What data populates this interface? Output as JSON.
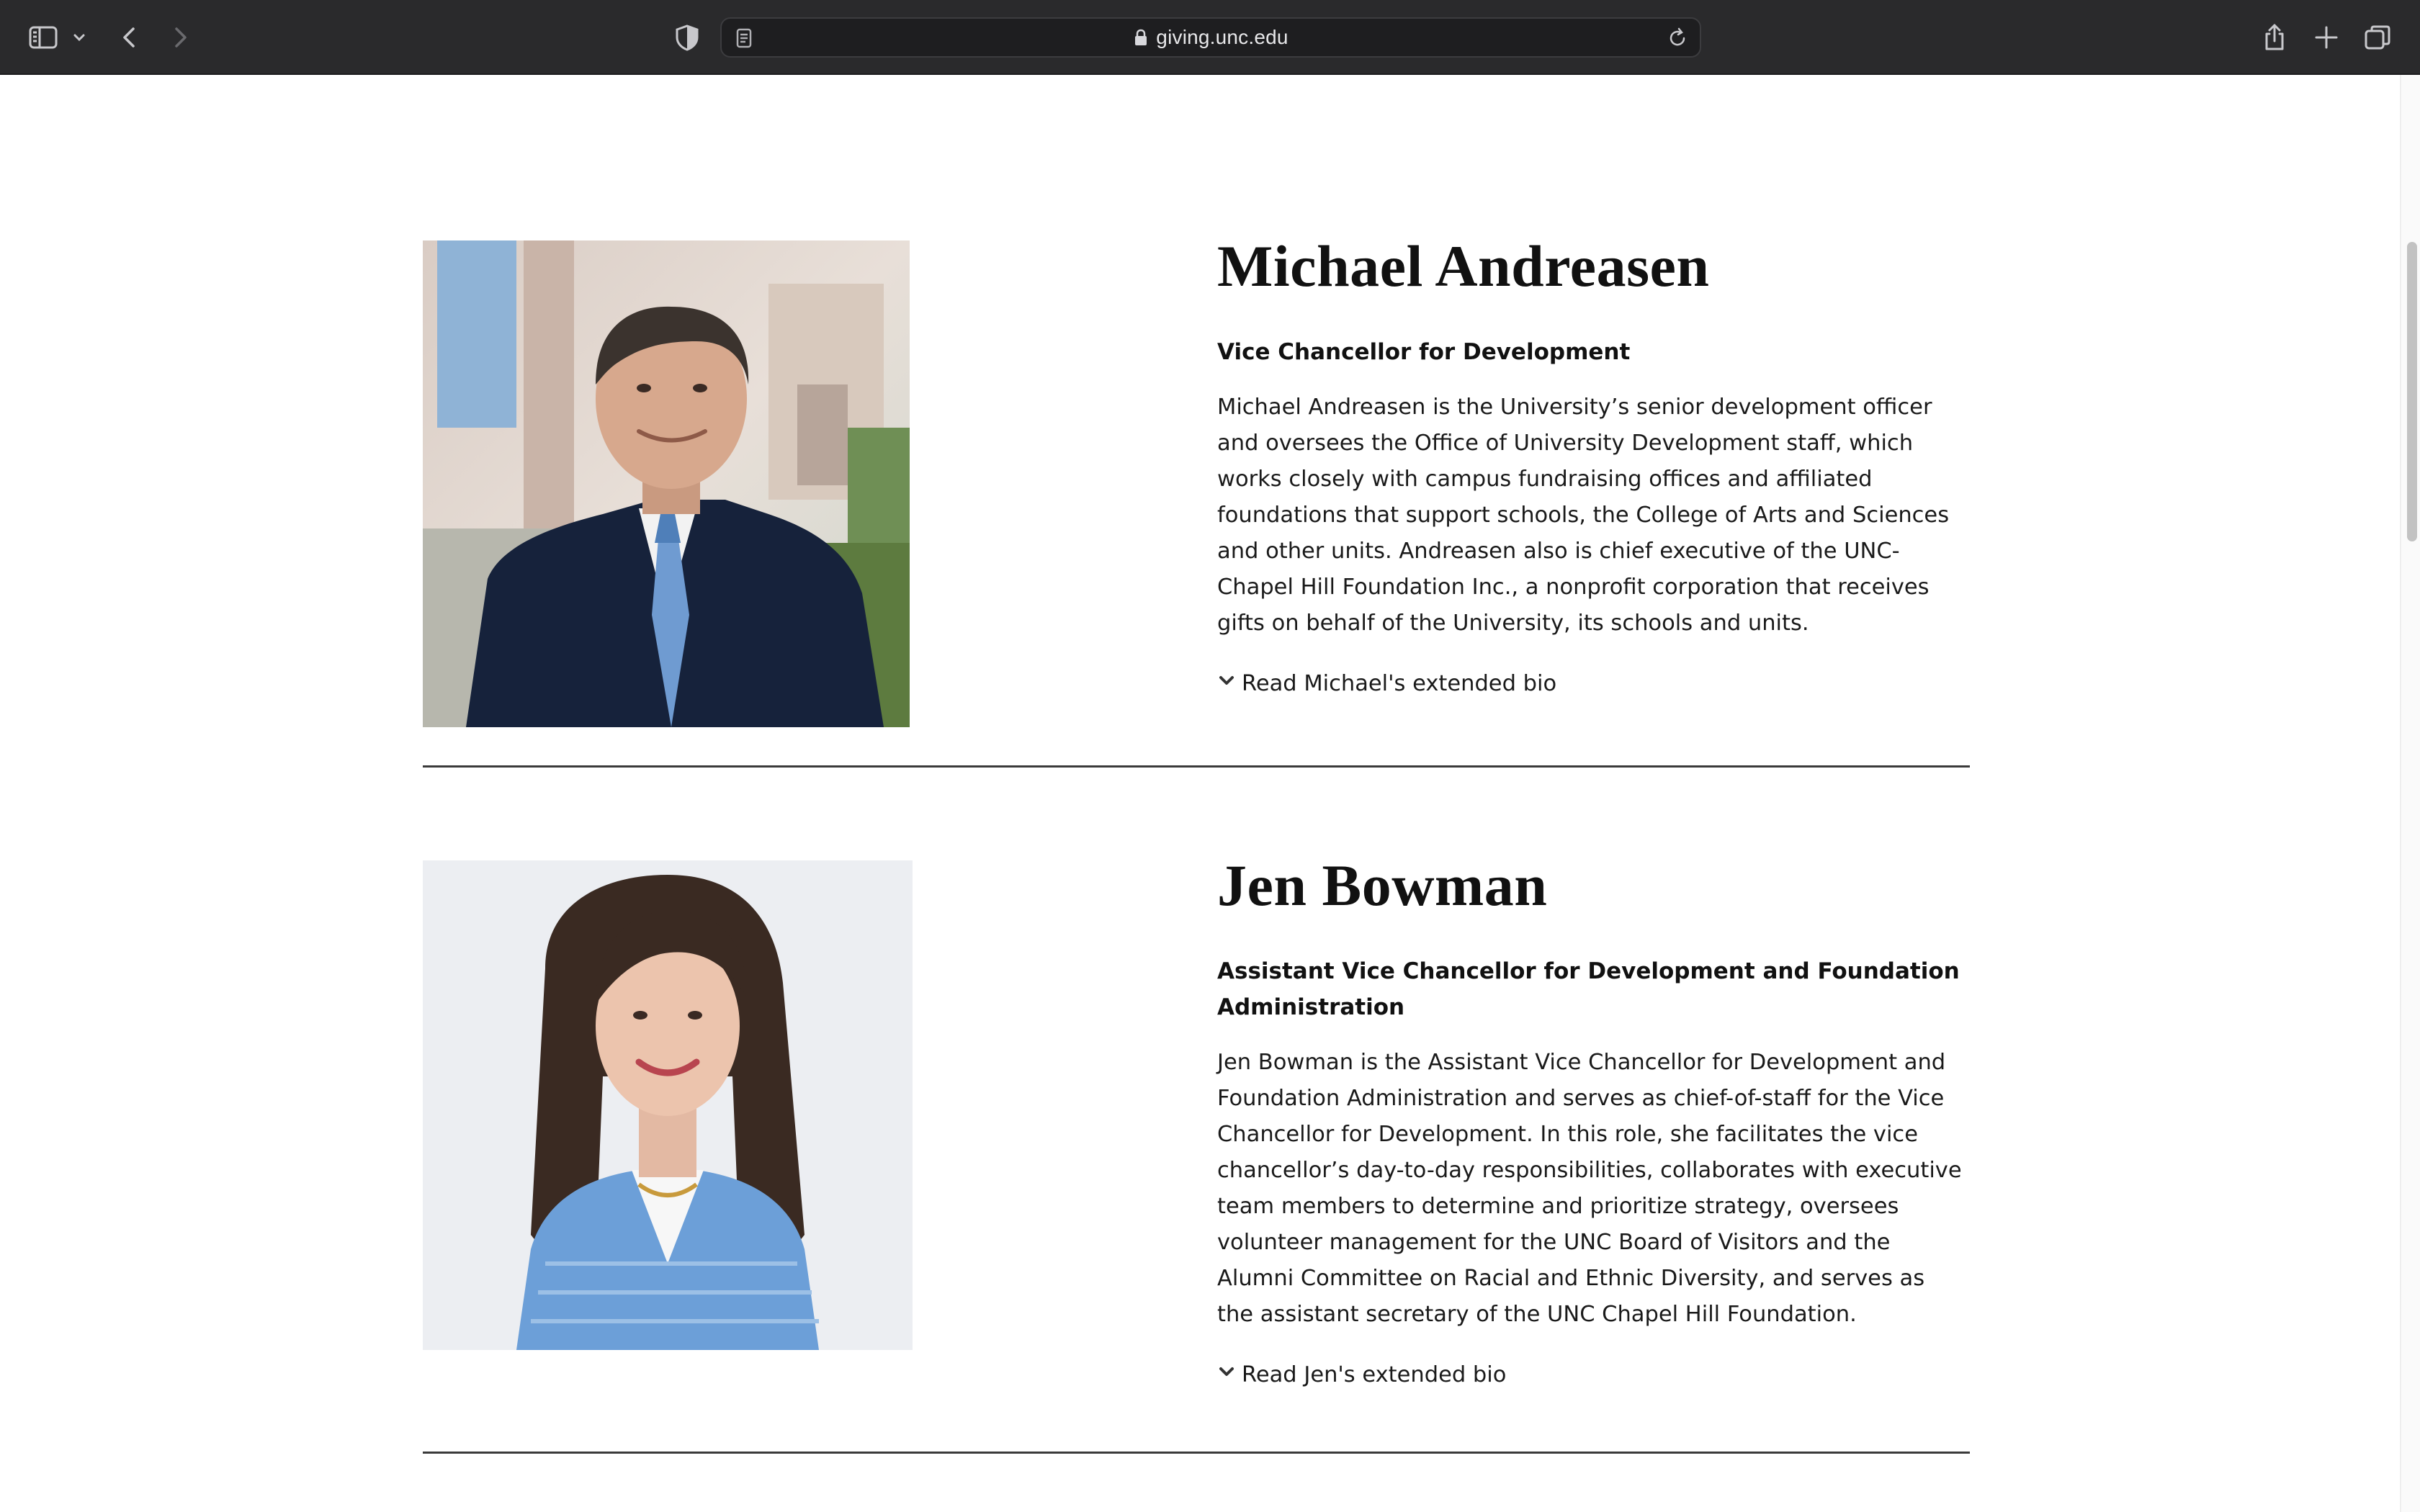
{
  "browser": {
    "url": "giving.unc.edu",
    "icons": [
      "sidebar-icon",
      "chevron-down-icon",
      "back-icon",
      "forward-icon",
      "privacy-shield-icon",
      "page-menu-icon",
      "lock-icon",
      "reload-icon",
      "share-icon",
      "new-tab-icon",
      "tab-overview-icon"
    ]
  },
  "profiles": [
    {
      "name": "Michael Andreasen",
      "title": "Vice Chancellor for Development",
      "bio": "Michael Andreasen is the University’s senior development officer and oversees the Office of University Development staff, which works closely with campus fundraising offices and affiliated foundations that support schools, the College of Arts and Sciences and other units. Andreasen also is chief executive of the UNC-Chapel Hill Foundation Inc., a nonprofit corporation that receives gifts on behalf of the University, its schools and units.",
      "extended_bio_link": "Read Michael's extended bio"
    },
    {
      "name": "Jen Bowman",
      "title": "Assistant Vice Chancellor for Development and Foundation Administration",
      "bio": "Jen Bowman is the Assistant Vice Chancellor for Development and Foundation Administration and serves as chief-of-staff for the Vice Chancellor for Development. In this role, she facilitates the vice chancellor’s day-to-day responsibilities, collaborates with executive team members to determine and prioritize strategy, oversees volunteer management for the UNC Board of Visitors and the Alumni Committee on Racial and Ethnic Diversity, and serves as the assistant secretary of the UNC Chapel Hill Foundation.",
      "extended_bio_link": "Read Jen's extended bio"
    }
  ]
}
